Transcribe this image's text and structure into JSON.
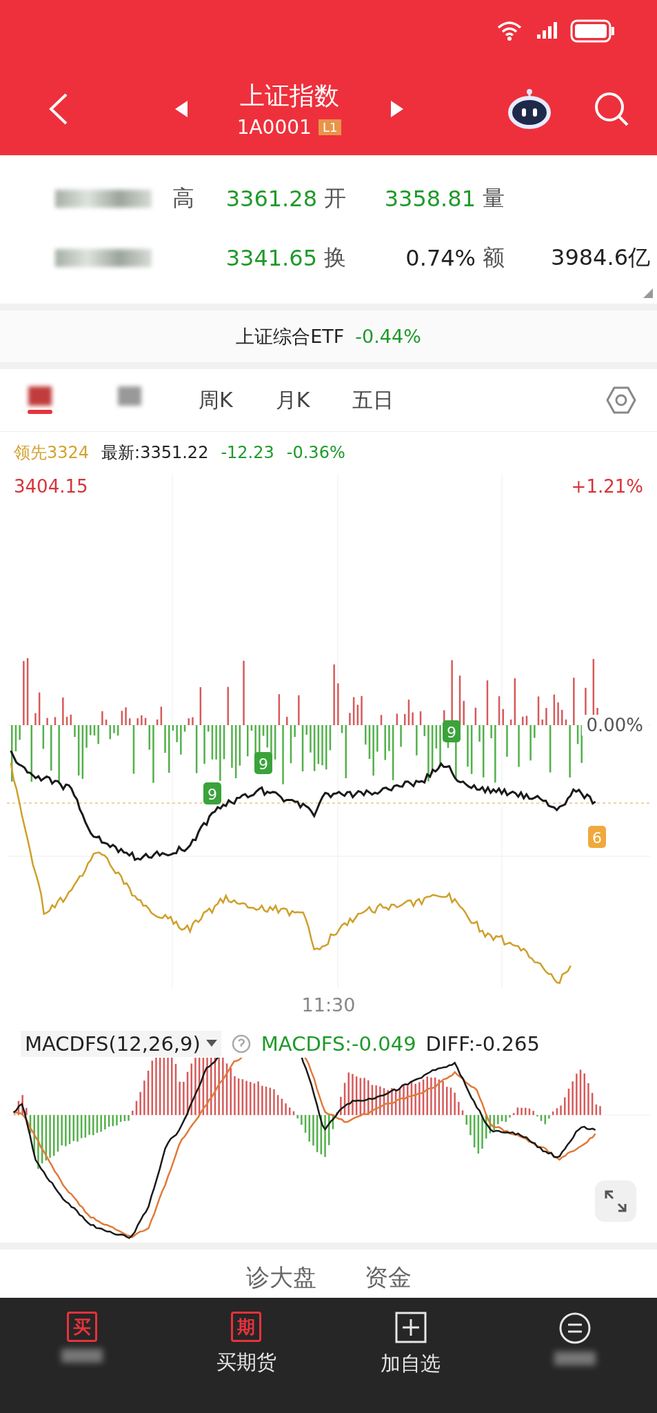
{
  "header": {
    "title": "上证指数",
    "code": "1A0001",
    "level_badge": "L1"
  },
  "quotes": [
    {
      "label": "高",
      "value": "3361.28",
      "color": "#1f9a2a"
    },
    {
      "label": "开",
      "value": "3358.81",
      "color": "#1f9a2a"
    },
    {
      "label": "量"
    },
    {
      "value": "3341.65",
      "color": "#1f9a2a"
    },
    {
      "label": "换",
      "value": "0.74%",
      "color": "#222222"
    },
    {
      "label": "额",
      "value": "3984.6亿",
      "color": "#222222"
    }
  ],
  "etf": {
    "name": "上证综合ETF",
    "change": "-0.44%"
  },
  "tabs": [
    {
      "kind": "blurred",
      "selected": true
    },
    {
      "kind": "blurred",
      "selected": false
    },
    {
      "kind": "text",
      "label": "周K",
      "selected": false
    },
    {
      "kind": "text",
      "label": "月K",
      "selected": false
    },
    {
      "kind": "text",
      "label": "五日",
      "selected": false
    }
  ],
  "info": {
    "lead": "领先3324",
    "latest": "最新:3351.22",
    "change": "-12.23",
    "percent": "-0.36%"
  },
  "chart": {
    "top_price": "3404.15",
    "top_percent": "+1.21%",
    "zero_percent": "0.00%",
    "time_label": "11:30",
    "signals": [
      {
        "label": "9",
        "color": "#3aa33a"
      },
      {
        "label": "9",
        "color": "#3aa33a"
      },
      {
        "label": "9",
        "color": "#3aa33a"
      },
      {
        "label": "6",
        "color": "#f0a93c"
      }
    ]
  },
  "macd": {
    "name": "MACDFS(12,26,9)",
    "macdfs": "MACDFS:-0.049",
    "diff": "DIFF:-0.265"
  },
  "bottom_tabs": [
    "诊大盘",
    "资金"
  ],
  "nav": [
    {
      "icon": "买",
      "color": "#e8323c"
    },
    {
      "icon": "期",
      "label": "买期货",
      "color": "#e8323c"
    },
    {
      "kind": "plus",
      "label": "加自选",
      "color": "#e6e6e6"
    },
    {
      "kind": "menu",
      "color": "#e6e6e6"
    }
  ]
}
